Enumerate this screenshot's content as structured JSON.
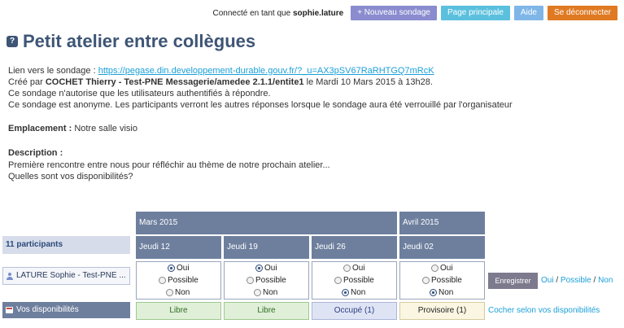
{
  "topbar": {
    "connected_prefix": "Connecté en tant que",
    "user": "sophie.lature",
    "new_poll": "+ Nouveau sondage",
    "home": "Page principale",
    "help": "Aide",
    "logout": "Se déconnecter"
  },
  "poll": {
    "title": "Petit atelier entre collègues",
    "link_label": "Lien vers le sondage :",
    "link_url": "https://pegase.din.developpement-durable.gouv.fr/?_u=AX3pSV67RaRHTGQ7mRcK",
    "created_prefix": "Créé par",
    "creator": "COCHET Thierry - Test-PNE Messagerie/amedee 2.1.1/entite1",
    "created_suffix": "le Mardi 10 Mars 2015 à 13h28.",
    "auth_note": "Ce sondage n'autorise que les utilisateurs authentifiés à répondre.",
    "anon_note": "Ce sondage est anonyme. Les participants verront les autres réponses lorsque le sondage aura été verrouillé par l'organisateur",
    "location_label": "Emplacement :",
    "location": "Notre salle visio",
    "description_label": "Description :",
    "description_line1": "Première rencontre entre nous pour réfléchir au thème de notre prochain atelier...",
    "description_line2": "Quelles sont vos disponibilités?"
  },
  "table": {
    "months": [
      "Mars 2015",
      "Avril 2015"
    ],
    "days": [
      "Jeudi 12",
      "Jeudi 19",
      "Jeudi 26",
      "Jeudi 02"
    ],
    "participants": "11 participants",
    "participant_name": "LATURE Sophie - Test-PNE ...",
    "availability_label": "Vos disponibilités",
    "option_labels": [
      "Oui",
      "Possible",
      "Non"
    ],
    "selected": [
      "Oui",
      "Oui",
      "Non",
      "Non"
    ],
    "statuses": [
      "Libre",
      "Libre",
      "Occupé (1)",
      "Provisoire (1)"
    ],
    "save": "Enregistrer",
    "quick_oui": "Oui",
    "quick_possible": "Possible",
    "quick_non": "Non",
    "quick_sep": "/",
    "check_availability": "Cocher selon vos disponibilités"
  }
}
